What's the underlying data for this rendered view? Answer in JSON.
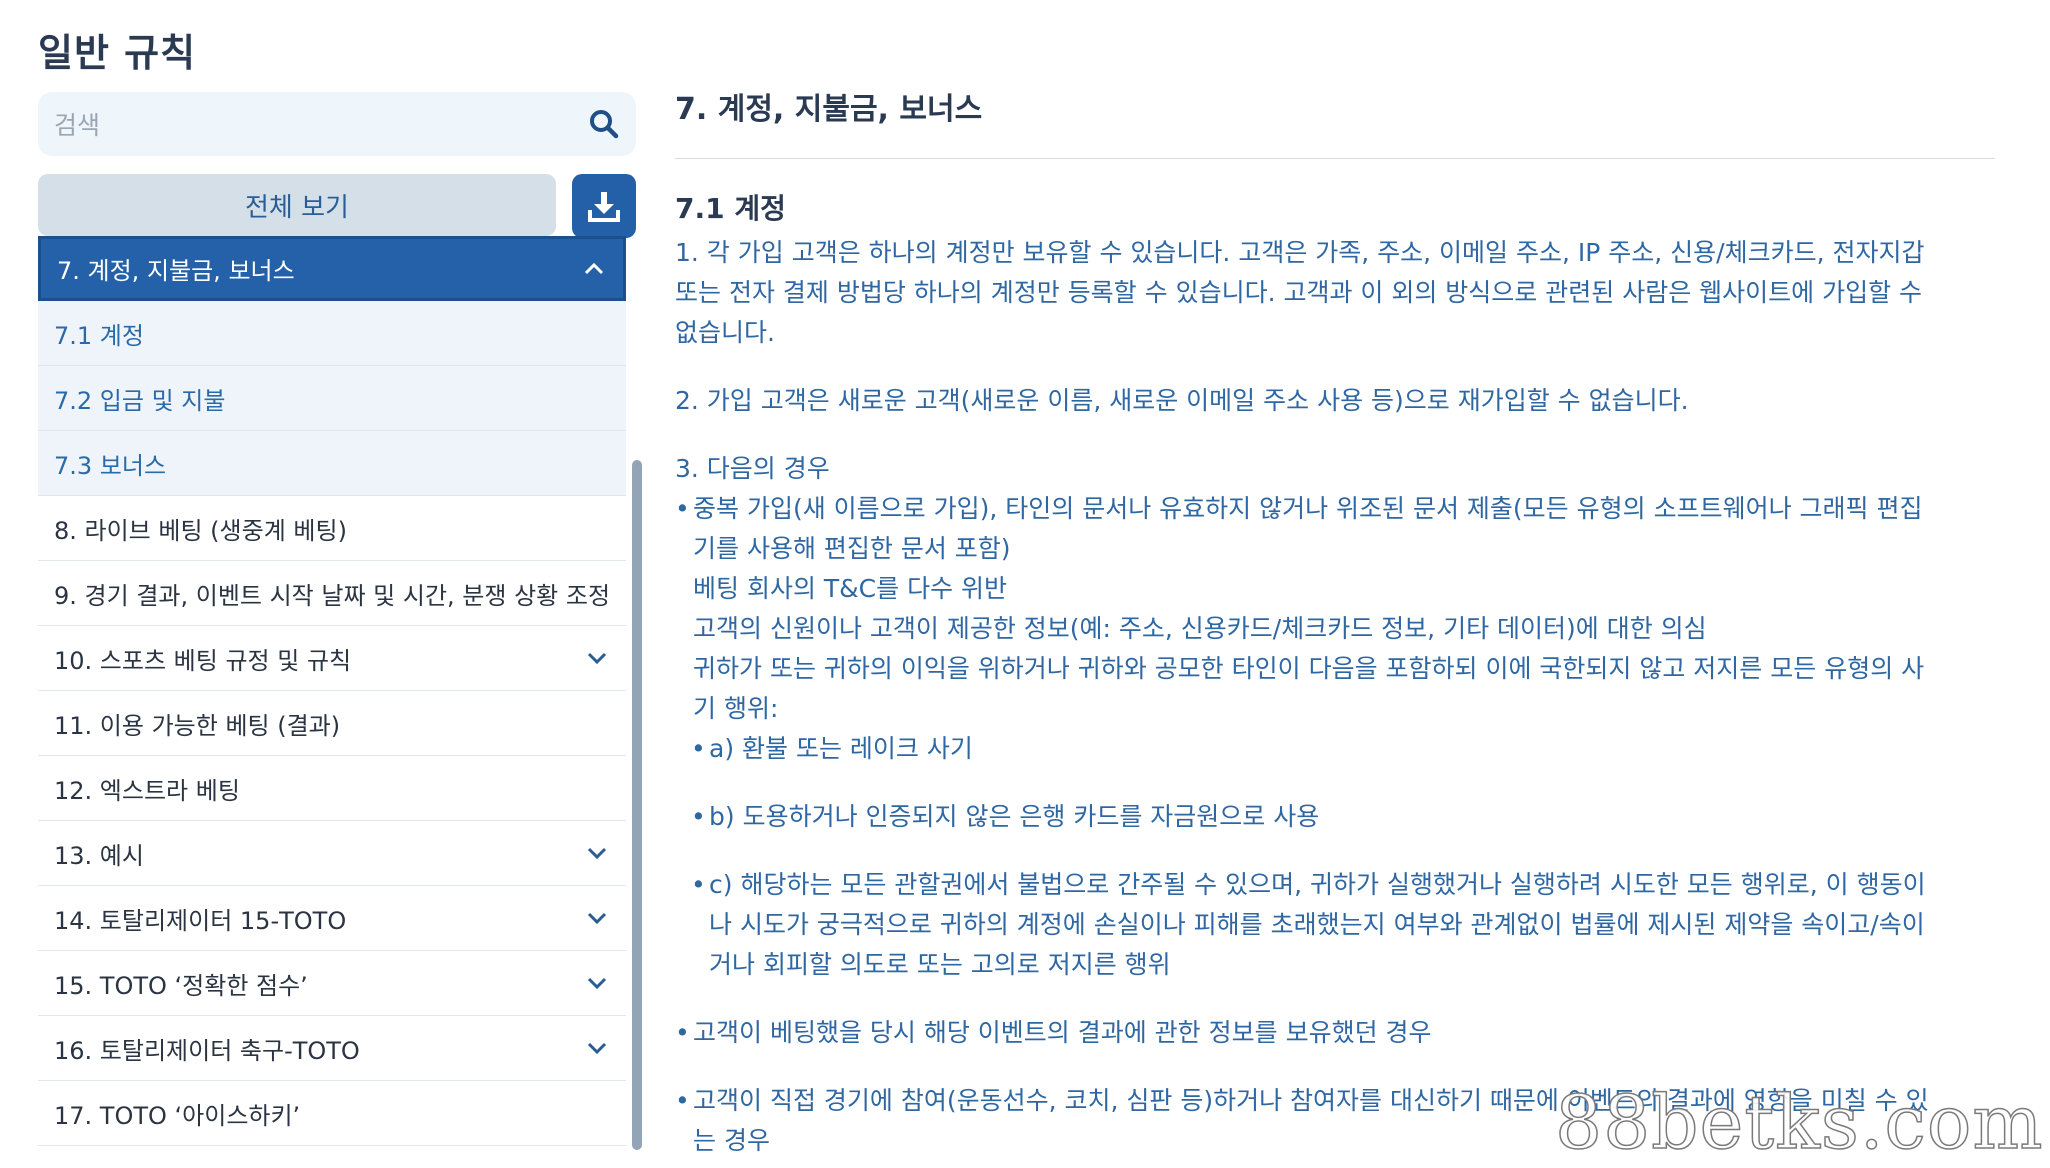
{
  "page": {
    "title": "일반 규칙"
  },
  "search": {
    "placeholder": "검색",
    "value": ""
  },
  "toolbar": {
    "view_all_label": "전체 보기"
  },
  "nav": {
    "items": [
      {
        "label": "7. 계정, 지불금, 보너스",
        "state": "active",
        "chevron": "up"
      },
      {
        "label": "7.1 계정",
        "state": "sub"
      },
      {
        "label": "7.2 입금 및 지불",
        "state": "sub"
      },
      {
        "label": "7.3 보너스",
        "state": "sub"
      },
      {
        "label": "8. 라이브 베팅 (생중계 베팅)"
      },
      {
        "label": "9. 경기 결과, 이벤트 시작 날짜 및 시간, 분쟁 상황 조정"
      },
      {
        "label": "10. 스포츠 베팅 규정 및 규칙",
        "chevron": "down"
      },
      {
        "label": "11. 이용 가능한 베팅 (결과)"
      },
      {
        "label": "12. 엑스트라 베팅"
      },
      {
        "label": "13. 예시",
        "chevron": "down"
      },
      {
        "label": "14. 토탈리제이터 15-TOTO",
        "chevron": "down"
      },
      {
        "label": "15. TOTO ‘정확한 점수’",
        "chevron": "down"
      },
      {
        "label": "16. 토탈리제이터 축구-TOTO",
        "chevron": "down"
      },
      {
        "label": "17. TOTO ‘아이스하키’"
      }
    ]
  },
  "content": {
    "section_title": "7. 계정, 지불금, 보너스",
    "subsection_title": "7.1 계정",
    "p1_line1": "1.  각 가입 고객은 하나의 계정만 보유할 수 있습니다. 고객은 가족, 주소, 이메일 주소, IP 주소, 신용/체크카드, 전자지갑",
    "p1_line2": "또는 전자 결제 방법당 하나의 계정만 등록할 수 있습니다. 고객과 이 외의 방식으로 관련된 사람은 웹사이트에 가입할 수",
    "p1_line3": "없습니다.",
    "p2": "2.  가입 고객은 새로운 고객(새로운 이름, 새로운 이메일 주소 사용 등)으로 재가입할 수 없습니다.",
    "p3": "3.  다음의 경우",
    "b1_line1": "중복 가입(새 이름으로 가입), 타인의 문서나 유효하지 않거나 위조된 문서 제출(모든 유형의 소프트웨어나 그래픽 편집",
    "b1_line2": "기를 사용해 편집한 문서 포함)",
    "b1_line3": "베팅 회사의 T&C를 다수 위반",
    "b1_line4": "고객의 신원이나 고객이 제공한 정보(예: 주소, 신용카드/체크카드 정보, 기타 데이터)에 대한 의심",
    "b1_line5": "귀하가 또는 귀하의 이익을 위하거나 귀하와 공모한 타인이 다음을 포함하되 이에 국한되지 않고 저지른 모든 유형의 사",
    "b1_line6": "기 행위:",
    "sub_a": "a) 환불 또는 레이크 사기",
    "sub_b": "b) 도용하거나 인증되지 않은 은행 카드를 자금원으로 사용",
    "sub_c_line1": "c) 해당하는 모든 관할권에서 불법으로 간주될 수 있으며, 귀하가 실행했거나 실행하려 시도한 모든 행위로, 이 행동이",
    "sub_c_line2": "나 시도가 궁극적으로 귀하의 계정에 손실이나 피해를 초래했는지 여부와 관계없이 법률에 제시된 제약을 속이고/속이",
    "sub_c_line3": "거나 회피할 의도로 또는 고의로 저지른 행위",
    "b2": "고객이 베팅했을 당시 해당 이벤트의 결과에 관한 정보를 보유했던 경우",
    "b3_line1": "고객이 직접 경기에 참여(운동선수, 코치, 심판 등)하거나 참여자를 대신하기 때문에 이벤트의 결과에 영향을 미칠 수 있",
    "b3_line2": "는 경우"
  },
  "watermark": {
    "text": "88betks.com"
  },
  "icons": {
    "search": "search-icon",
    "download": "download-icon",
    "chevron_up": "chevron-up-icon",
    "chevron_down": "chevron-down-icon"
  },
  "colors": {
    "accent": "#2461a8",
    "text_blue": "#2f67a3",
    "title": "#2a3a52",
    "sub_bg": "#eef4f9"
  }
}
